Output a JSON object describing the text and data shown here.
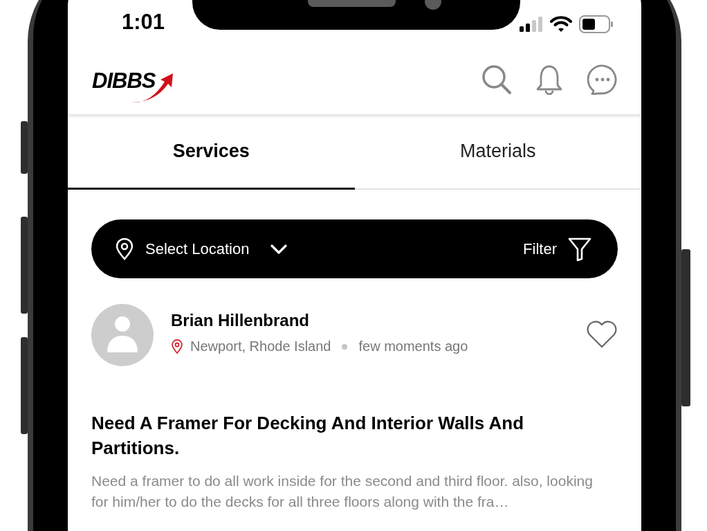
{
  "status_bar": {
    "time": "1:01"
  },
  "header": {
    "logo": "DIBBS"
  },
  "tabs": [
    {
      "label": "Services",
      "selected": true
    },
    {
      "label": "Materials",
      "selected": false
    }
  ],
  "location_bar": {
    "location": "Select Location",
    "filter": "Filter"
  },
  "post": {
    "author": "Brian Hillenbrand",
    "location": "Newport, Rhode Island",
    "time": "few moments ago",
    "title": "Need A Framer For Decking And Interior Walls And Partitions.",
    "description": "Need a framer to do all work inside for the second and third floor. also, looking for him/her to do the decks for all three floors along with the fra…"
  }
}
